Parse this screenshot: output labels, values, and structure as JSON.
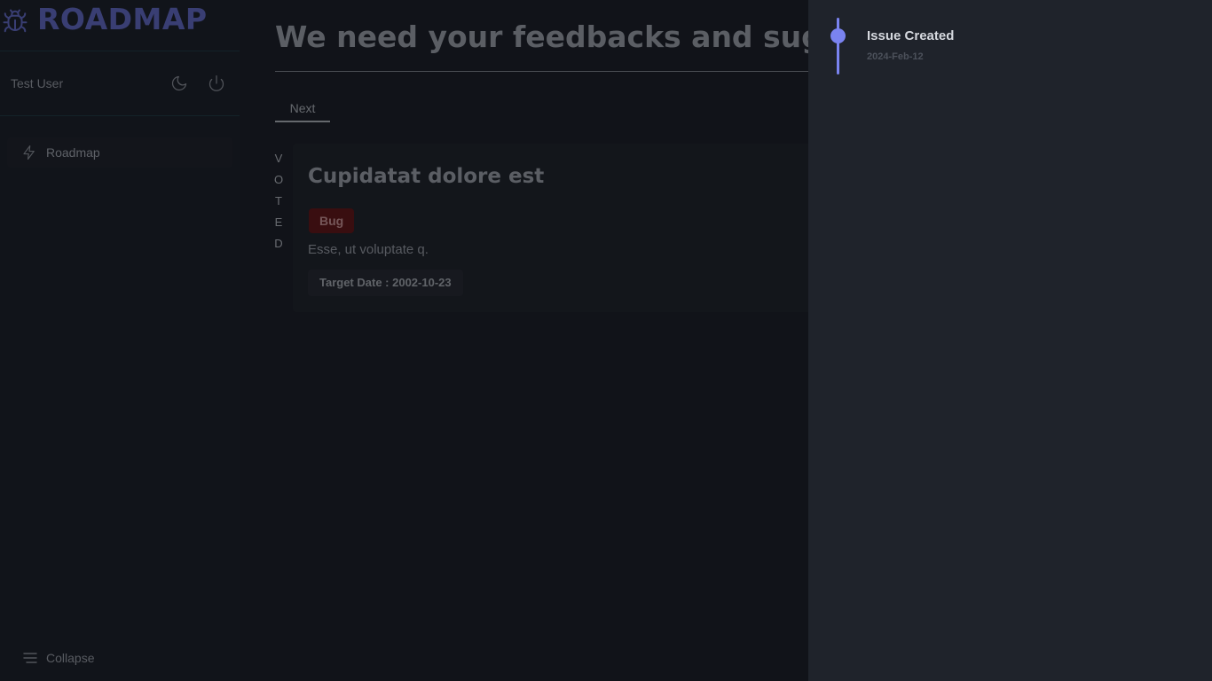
{
  "sidebar": {
    "brand": "ROADMAP",
    "user_name": "Test User",
    "nav": [
      {
        "label": "Roadmap",
        "icon": "lightning-icon"
      }
    ],
    "collapse_label": "Collapse"
  },
  "main": {
    "title": "We need your feedbacks and suggestions",
    "tabs": [
      {
        "label": "Next"
      }
    ],
    "voted_label": [
      "V",
      "O",
      "T",
      "E",
      "D"
    ],
    "card": {
      "title": "Cupidatat dolore est",
      "badge": "Bug",
      "description": "Esse, ut voluptate q.",
      "target_date": "Target Date : 2002-10-23"
    }
  },
  "drawer": {
    "timeline": [
      {
        "title": "Issue Created",
        "date": "2024-Feb-12"
      }
    ]
  },
  "colors": {
    "accent": "#7a83f0",
    "brand": "#6a73d8",
    "bug_badge": "#6b1212"
  }
}
